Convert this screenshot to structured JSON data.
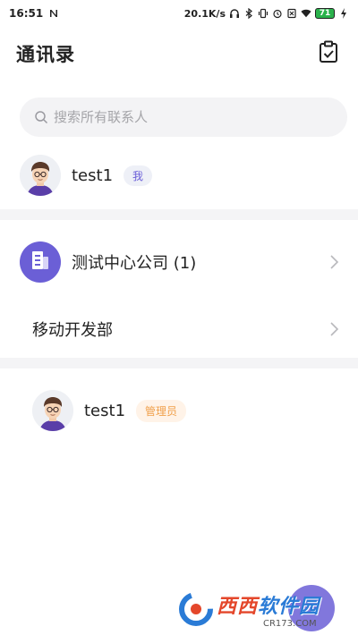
{
  "status_bar": {
    "time": "16:51",
    "network_speed": "20.1K/s",
    "battery_level": "71",
    "icons": [
      "notification-n-icon",
      "headset-icon",
      "bluetooth-icon",
      "vibrate-icon",
      "alarm-icon",
      "sim-off-icon",
      "wifi-icon",
      "battery-icon",
      "charging-icon"
    ]
  },
  "header": {
    "title": "通讯录",
    "right_icon": "clipboard-check-icon"
  },
  "search": {
    "placeholder": "搜索所有联系人"
  },
  "me": {
    "name": "test1",
    "badge": "我"
  },
  "company": {
    "name": "测试中心公司 (1)",
    "icon": "building-icon",
    "accent": "#6b5fd6"
  },
  "department": {
    "name": "移动开发部"
  },
  "members": [
    {
      "name": "test1",
      "badge": "管理员"
    }
  ],
  "watermark": {
    "title_a": "西西",
    "title_b": "软件园",
    "url": "CR173.COM"
  }
}
